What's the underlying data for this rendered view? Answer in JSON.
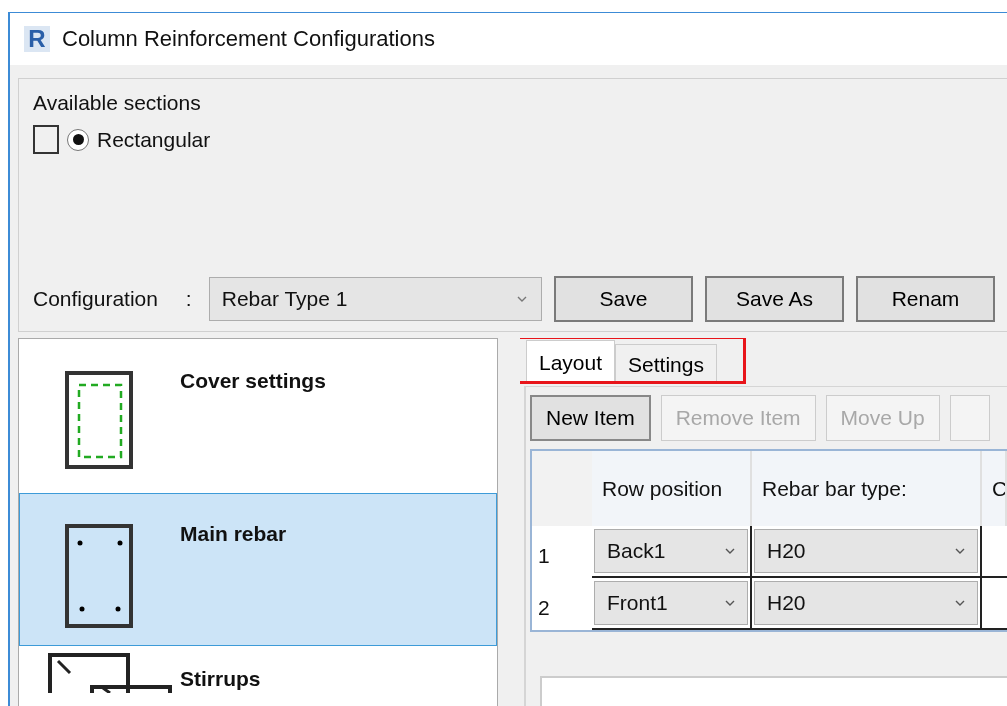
{
  "window": {
    "title": "Column Reinforcement Configurations",
    "app_letter": "R"
  },
  "available_sections": {
    "label": "Available sections",
    "items": [
      {
        "label": "Rectangular",
        "checked": false,
        "selected": true
      }
    ]
  },
  "configuration": {
    "label": "Configuration",
    "separator": ":",
    "value": "Rebar Type 1",
    "buttons": [
      "Save",
      "Save As",
      "Renam"
    ]
  },
  "sidebar": {
    "items": [
      {
        "kind": "cover",
        "label": "Cover settings",
        "selected": false
      },
      {
        "kind": "main",
        "label": "Main rebar",
        "selected": true
      },
      {
        "kind": "stirrups",
        "label": "Stirrups",
        "selected": false
      }
    ]
  },
  "tabs": [
    {
      "label": "Layout",
      "selected": true
    },
    {
      "label": "Settings",
      "selected": false
    }
  ],
  "toolbar": [
    {
      "label": "New Item",
      "disabled": false
    },
    {
      "label": "Remove Item",
      "disabled": true
    },
    {
      "label": "Move Up",
      "disabled": true
    }
  ],
  "table": {
    "columns": [
      "Row position",
      "Rebar bar type:",
      "C"
    ],
    "rows": [
      {
        "number": "1",
        "row_position": "Back1",
        "bar_type": "H20"
      },
      {
        "number": "2",
        "row_position": "Front1",
        "bar_type": "H20"
      }
    ]
  }
}
